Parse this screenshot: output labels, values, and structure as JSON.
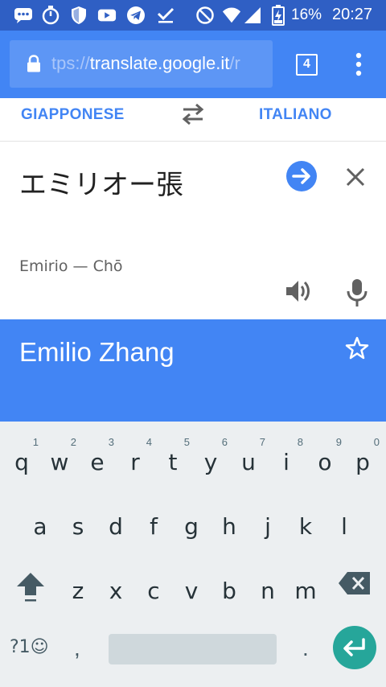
{
  "status_bar": {
    "battery_percent": "16%",
    "time": "20:27",
    "icons": [
      "messaging-icon",
      "stopwatch-icon",
      "shield-icon",
      "youtube-icon",
      "telegram-icon",
      "download-done-icon",
      "do-not-disturb-icon",
      "wifi-icon",
      "cell-signal-icon",
      "battery-charging-icon"
    ]
  },
  "browser": {
    "url_prefix": "tps://",
    "url_domain": "translate.google.it",
    "url_suffix": "/r",
    "tab_count": "4"
  },
  "languages": {
    "source": "GIAPPONESE",
    "target": "ITALIANO"
  },
  "input": {
    "text": "エミリオー張",
    "transliteration": "Emirio — Chō"
  },
  "result": {
    "text": "Emilio Zhang"
  },
  "keyboard": {
    "row1": [
      {
        "key": "q",
        "num": "1"
      },
      {
        "key": "w",
        "num": "2"
      },
      {
        "key": "e",
        "num": "3"
      },
      {
        "key": "r",
        "num": "4"
      },
      {
        "key": "t",
        "num": "5"
      },
      {
        "key": "y",
        "num": "6"
      },
      {
        "key": "u",
        "num": "7"
      },
      {
        "key": "i",
        "num": "8"
      },
      {
        "key": "o",
        "num": "9"
      },
      {
        "key": "p",
        "num": "0"
      }
    ],
    "row2": [
      "a",
      "s",
      "d",
      "f",
      "g",
      "h",
      "j",
      "k",
      "l"
    ],
    "row3": [
      "z",
      "x",
      "c",
      "v",
      "b",
      "n",
      "m"
    ],
    "symbols_label": "?1☺",
    "comma": ",",
    "period": "."
  },
  "colors": {
    "status_bar": "#2f5fc4",
    "chrome": "#4285f4",
    "accent": "#4285f4",
    "enter_key": "#26a69a",
    "keyboard_bg": "#eceff1"
  }
}
